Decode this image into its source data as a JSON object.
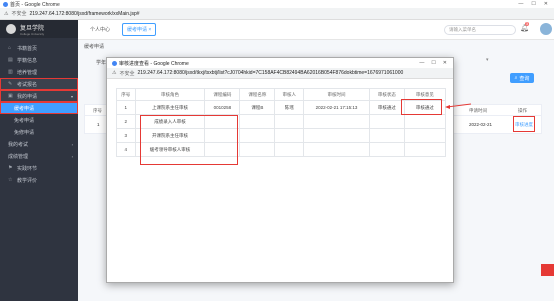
{
  "browser": {
    "title": "首页 - Google Chrome",
    "insecure": "不安全",
    "url": "219.247.64.172:8080/jsxd/framework/xxMain.jsp#"
  },
  "sidebar": {
    "logo_name": "复旦学院",
    "logo_sub": "College University",
    "items": [
      {
        "label": "书籍首页",
        "icon": "home-icon"
      },
      {
        "label": "学籍信息",
        "icon": "id-card-icon"
      },
      {
        "label": "培养管理",
        "icon": "book-icon"
      },
      {
        "label": "考试报名",
        "icon": "edit-icon"
      },
      {
        "label": "我的申请",
        "icon": "folder-icon"
      },
      {
        "label": "缓考申请"
      },
      {
        "label": "免考申请"
      },
      {
        "label": "免修申请"
      },
      {
        "label": "我的考试"
      },
      {
        "label": "成绩管理"
      },
      {
        "label": "实践环节",
        "icon": "flag-icon"
      },
      {
        "label": "教学评价",
        "icon": "star-icon"
      }
    ]
  },
  "topbar": {
    "tab_personal": "个人中心",
    "tab_current": "缓考申请",
    "search_placeholder": "请输入菜单名",
    "notifications": "3"
  },
  "main": {
    "title": "缓考申请",
    "filter_label": "学年",
    "query_label": "查询",
    "bg_header_seq": "序号",
    "bg_header_time": "申请时间",
    "bg_header_op": "操作",
    "bg_row_seq": "1",
    "bg_row_time": "2022-02-21",
    "bg_row_op": "审核进度"
  },
  "modal": {
    "title": "审核进度查看 - Google Chrome",
    "insecure": "不安全",
    "url": "219.247.64.172:8080/jsxd/tkxj/tsxbtj/list?cJ0704hkid=7C158AF4CB82494BA62016B054F876dokbtime=1676971061000",
    "headers": [
      "序号",
      "审核角色",
      "课程编码",
      "课程名称",
      "审核人",
      "审核时间",
      "审核状态",
      "审核意见"
    ],
    "rows": [
      [
        "1",
        "上课院系主任审核",
        "0010258",
        "课程B",
        "陈瑶",
        "2022-02-21 17:15:13",
        "审核通过",
        "审核通过"
      ],
      [
        "2",
        "成绩录入人审核",
        "",
        "",
        "",
        "",
        "",
        ""
      ],
      [
        "3",
        "开课院系主任审核",
        "",
        "",
        "",
        "",
        "",
        ""
      ],
      [
        "4",
        "缓考领导审核人审核",
        "",
        "",
        "",
        "",
        "",
        ""
      ]
    ]
  },
  "colors": {
    "accent": "#409eff",
    "sidebar_bg": "#2f3440",
    "highlight_red": "#e53935"
  }
}
